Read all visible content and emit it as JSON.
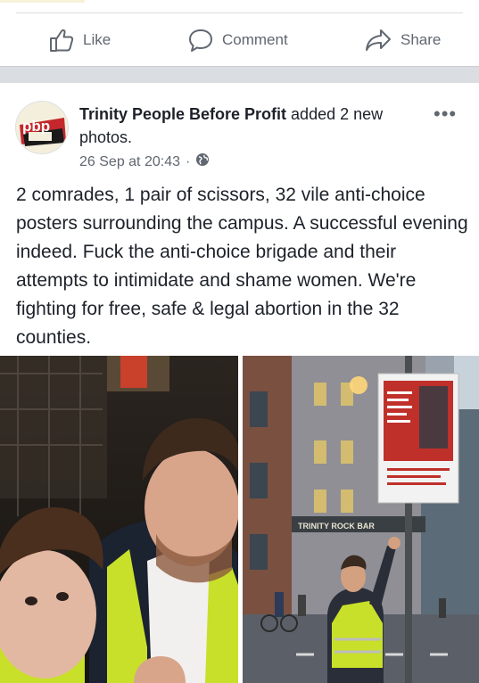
{
  "actions": {
    "like": "Like",
    "comment": "Comment",
    "share": "Share"
  },
  "post": {
    "page_name": "Trinity People Before Profit",
    "activity": " added 2 new photos.",
    "timestamp": "26 Sep at 20:43",
    "separator": " · ",
    "privacy_icon": "globe-icon",
    "more_label": "•••",
    "text": "2 comrades, 1 pair of scissors, 32 vile anti-choice posters surrounding the campus. A successful evening indeed. Fuck the anti-choice brigade and their attempts to intimidate and shame women. We're fighting for free, safe & legal abortion in the 32 counties.",
    "avatar_text": "pbp"
  },
  "photos": {
    "right_sign_text": "TRINITY ROCK BAR"
  },
  "colors": {
    "action_text": "#606770",
    "separator": "#dadde1",
    "hi_vis": "#c8e02a",
    "poster_red": "#c0302a"
  }
}
